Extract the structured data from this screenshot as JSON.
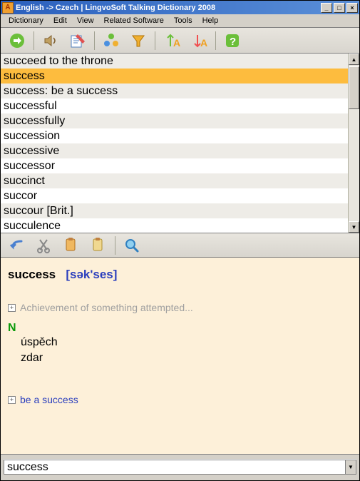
{
  "titlebar": {
    "title": "English -> Czech | LingvoSoft Talking Dictionary 2008"
  },
  "menu": [
    "Dictionary",
    "Edit",
    "View",
    "Related Software",
    "Tools",
    "Help"
  ],
  "toolbar1_icons": [
    "swap-icon",
    "speak-icon",
    "edit-icon",
    "apps-icon",
    "filter-icon",
    "font-up-icon",
    "font-down-icon",
    "help-icon"
  ],
  "wordlist": [
    "succeed to the throne",
    "success",
    "success: be a success",
    "successful",
    "successfully",
    "succession",
    "successive",
    "successor",
    "succinct",
    "succor",
    "succour [Brit.]",
    "succulence"
  ],
  "selected_index": 1,
  "toolbar2_icons": [
    "back-icon",
    "cut-icon",
    "copy-icon",
    "paste-icon",
    "find-icon"
  ],
  "definition": {
    "headword": "success",
    "phonetic": "[sək'ses]",
    "hint": "Achievement of something attempted...",
    "pos": "N",
    "translations": [
      "úspěch",
      "zdar"
    ],
    "related": "be a success"
  },
  "search": {
    "value": "success"
  }
}
